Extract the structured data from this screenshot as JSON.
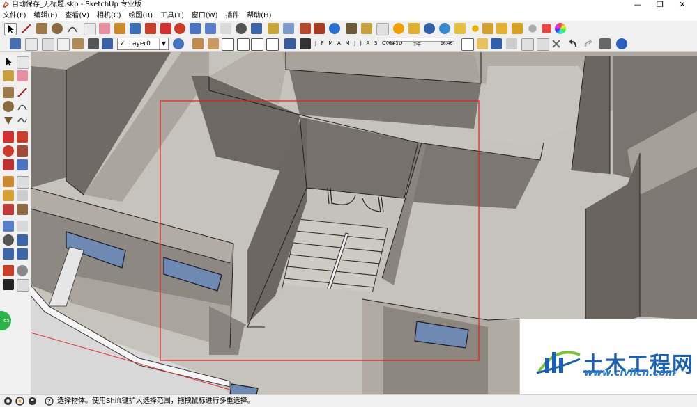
{
  "window": {
    "title": "自动保存_无标题.skp - SketchUp 专业版",
    "minimize": "—",
    "maximize": "❐",
    "close": "✕"
  },
  "menu": [
    "文件(F)",
    "编辑(E)",
    "查看(V)",
    "相机(C)",
    "绘图(R)",
    "工具(T)",
    "窗口(W)",
    "插件",
    "帮助(H)"
  ],
  "layer": {
    "current": "Layer0",
    "visible_check": "✓"
  },
  "shadow": {
    "months": "J F M A M J J A S O N D",
    "time_start": "06:43",
    "time_mid": "中午",
    "time_end": "16:46"
  },
  "left_badge": "65",
  "status": {
    "text": "选择物体。使用Shift键扩大选择范围，拖拽鼠标进行多重选择。"
  },
  "watermark": {
    "title": "土木工程网",
    "url": "www.civilcn.com"
  },
  "colors": {
    "wall": "#b4aea7",
    "floor": "#cbc7c0",
    "shadow_wall": "#7d7771",
    "selection": "#e02020",
    "window_glass": "#6e8ab2"
  }
}
